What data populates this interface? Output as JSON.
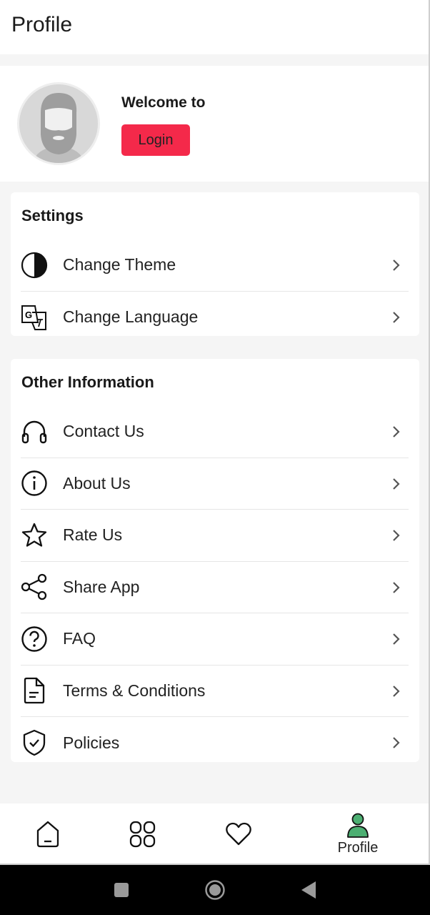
{
  "header": {
    "title": "Profile"
  },
  "profile": {
    "welcome": "Welcome to",
    "login_label": "Login",
    "login_color": "#f4294a"
  },
  "settings": {
    "title": "Settings",
    "items": [
      {
        "label": "Change Theme",
        "icon": "theme-icon"
      },
      {
        "label": "Change Language",
        "icon": "translate-icon"
      }
    ]
  },
  "other": {
    "title": "Other Information",
    "items": [
      {
        "label": "Contact Us",
        "icon": "headset-icon"
      },
      {
        "label": "About Us",
        "icon": "info-icon"
      },
      {
        "label": "Rate Us",
        "icon": "star-icon"
      },
      {
        "label": "Share App",
        "icon": "share-icon"
      },
      {
        "label": "FAQ",
        "icon": "question-icon"
      },
      {
        "label": "Terms & Conditions",
        "icon": "document-icon"
      },
      {
        "label": "Policies",
        "icon": "shield-check-icon"
      }
    ]
  },
  "nav": {
    "items": [
      {
        "icon": "home-icon"
      },
      {
        "icon": "grid-icon"
      },
      {
        "icon": "heart-icon"
      },
      {
        "icon": "person-icon",
        "label": "Profile",
        "active": true
      }
    ],
    "active_color": "#4caf72"
  }
}
